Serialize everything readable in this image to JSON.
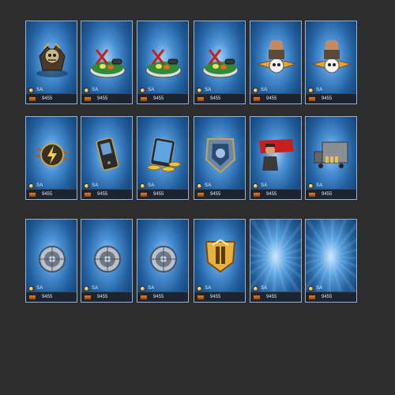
{
  "cards": [
    {
      "rank": "SA",
      "price": "9455",
      "icon": "zombie-emblem-icon"
    },
    {
      "rank": "SA",
      "price": "9455",
      "icon": "grenade-pack-icon"
    },
    {
      "rank": "SA",
      "price": "9455",
      "icon": "grenade-pack-icon"
    },
    {
      "rank": "SA",
      "price": "9455",
      "icon": "grenade-pack-icon"
    },
    {
      "rank": "SA",
      "price": "9455",
      "icon": "soldier-skull-badge-icon"
    },
    {
      "rank": "SA",
      "price": "9455",
      "icon": "soldier-skull-badge-icon"
    },
    {
      "rank": "SA",
      "price": "9455",
      "icon": "lightning-crest-icon"
    },
    {
      "rank": "SA",
      "price": "9455",
      "icon": "mobile-phone-icon"
    },
    {
      "rank": "SA",
      "price": "9455",
      "icon": "tablet-gold-coins-icon"
    },
    {
      "rank": "SA",
      "price": "9455",
      "icon": "armored-shield-icon"
    },
    {
      "rank": "SA",
      "price": "9455",
      "icon": "red-flag-officer-icon"
    },
    {
      "rank": "SA",
      "price": "9455",
      "icon": "cargo-truck-icon"
    },
    {
      "rank": "SA",
      "price": "9455",
      "icon": "engine-gear-icon"
    },
    {
      "rank": "SA",
      "price": "9455",
      "icon": "engine-gear-icon"
    },
    {
      "rank": "SA",
      "price": "9455",
      "icon": "engine-gear-icon"
    },
    {
      "rank": "SA",
      "price": "9455",
      "icon": "gold-shield-icon"
    },
    {
      "rank": "SA",
      "price": "9455",
      "icon": ""
    },
    {
      "rank": "SA",
      "price": "9455",
      "icon": ""
    }
  ]
}
